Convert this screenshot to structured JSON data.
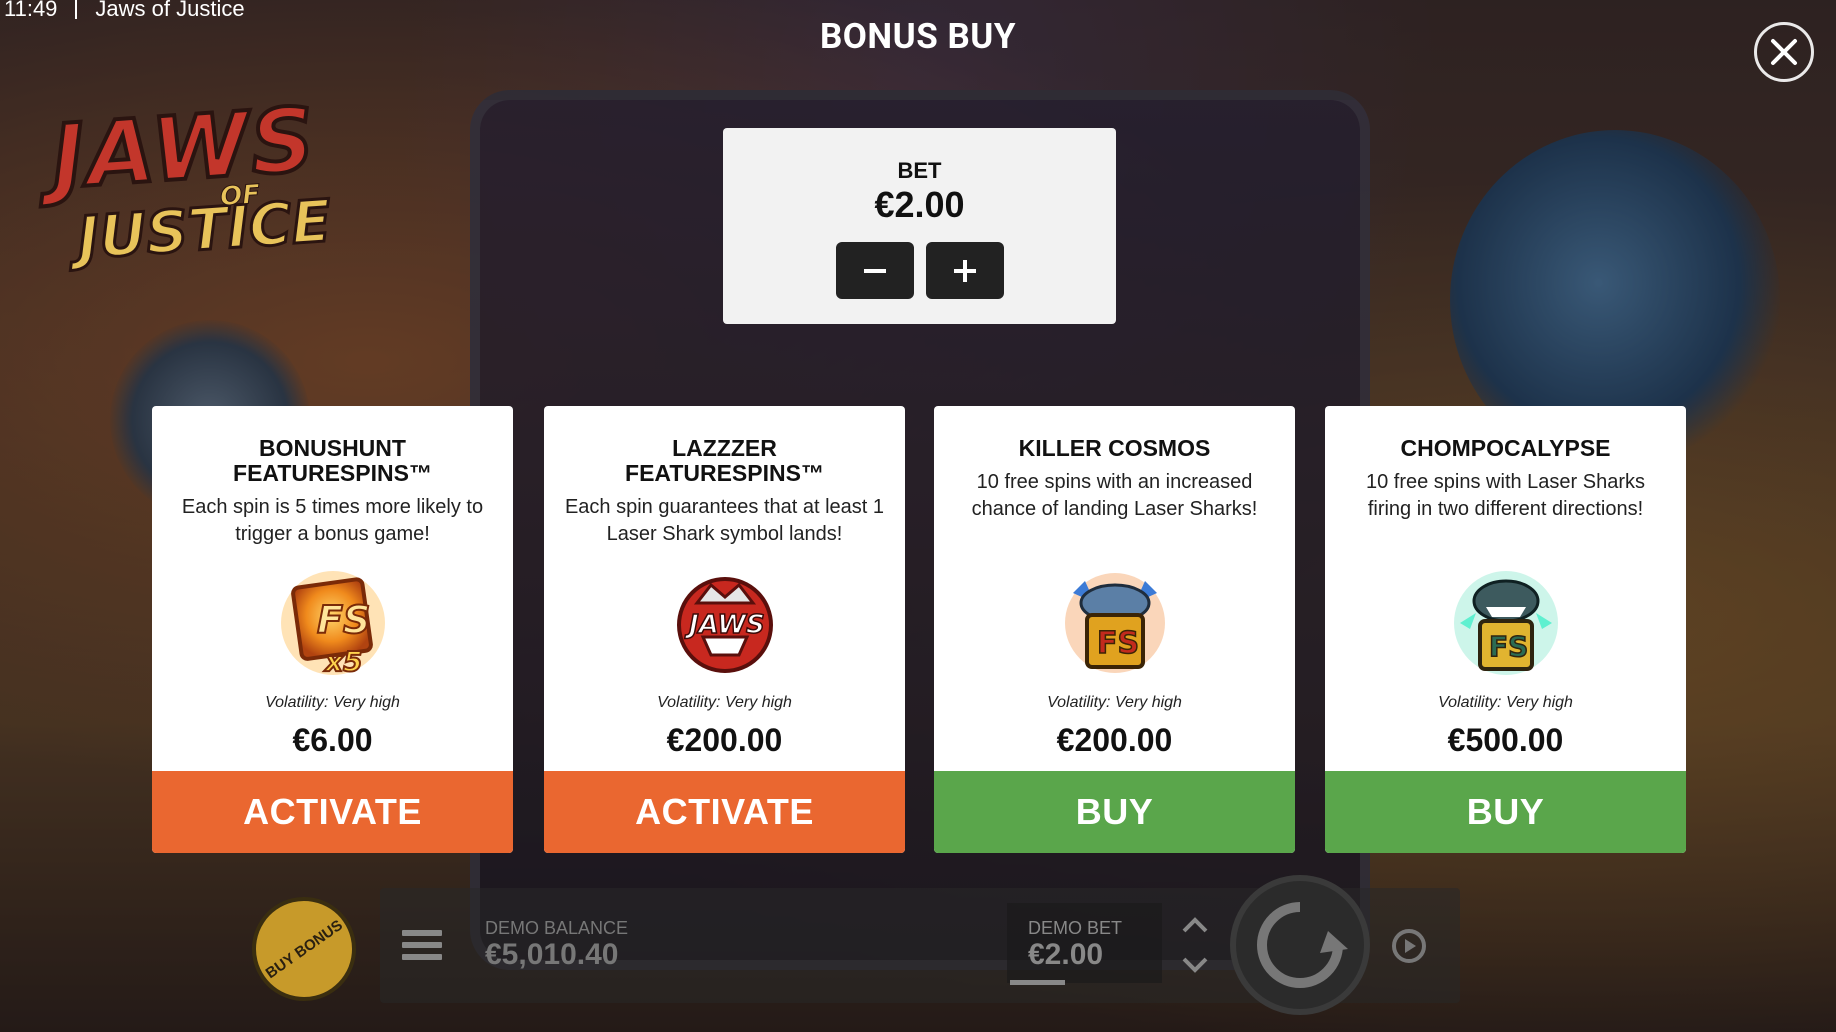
{
  "status_bar": {
    "time": "11:49",
    "app_title": "Jaws of Justice"
  },
  "logo": {
    "main": "JAWS",
    "of": "OF",
    "sub": "JUSTICE"
  },
  "header": {
    "title": "BONUS BUY"
  },
  "bet_panel": {
    "label": "BET",
    "value": "€2.00",
    "decrease_symbol": "−",
    "increase_symbol": "+"
  },
  "cards": [
    {
      "title": "BONUSHUNT FEATURESPINS™",
      "description": "Each spin is 5 times more likely to trigger a bonus game!",
      "icon": "bonushunt-fs-x5-icon",
      "volatility": "Volatility: Very high",
      "price": "€6.00",
      "button": "ACTIVATE",
      "button_color": "#ea6730"
    },
    {
      "title": "LAZZZER FEATURESPINS™",
      "description": "Each spin guarantees that at least 1 Laser Shark symbol lands!",
      "icon": "jaws-shark-badge-icon",
      "volatility": "Volatility: Very high",
      "price": "€200.00",
      "button": "ACTIVATE",
      "button_color": "#ea6730"
    },
    {
      "title": "KILLER COSMOS",
      "description": "10 free spins with an increased chance of landing Laser Sharks!",
      "icon": "killer-cosmos-shark-fs-icon",
      "volatility": "Volatility: Very high",
      "price": "€200.00",
      "button": "BUY",
      "button_color": "#5aa64b"
    },
    {
      "title": "CHOMPOCALYPSE",
      "description": "10 free spins with Laser Sharks firing in two different directions!",
      "icon": "chompocalypse-shark-fs-icon",
      "volatility": "Volatility: Very high",
      "price": "€500.00",
      "button": "BUY",
      "button_color": "#5aa64b"
    }
  ],
  "bottom_bar": {
    "buy_bonus_label": "BUY BONUS",
    "balance_label": "DEMO BALANCE",
    "balance_value": "€5,010.40",
    "bet_label": "DEMO BET",
    "bet_value": "€2.00"
  },
  "colors": {
    "activate": "#ea6730",
    "buy": "#5aa64b",
    "bet_button": "#222222",
    "panel": "#f2f2f2"
  }
}
